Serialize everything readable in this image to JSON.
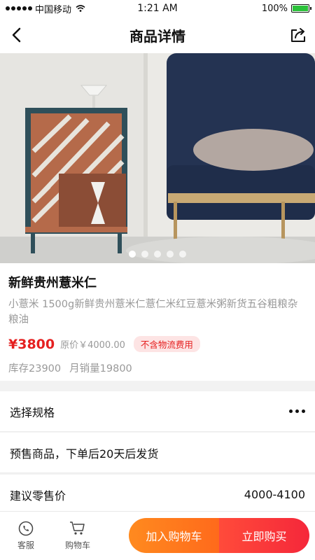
{
  "status_bar": {
    "carrier": "中国移动",
    "time": "1:21 AM",
    "battery": "100%",
    "battery_level": 1.0
  },
  "nav": {
    "title": "商品详情"
  },
  "carousel": {
    "count": 5,
    "active_index": 0
  },
  "product": {
    "name": "新鲜贵州薏米仁",
    "description": "小薏米 1500g新鲜贵州薏米仁薏仁米红豆薏米粥新货五谷粗粮杂粮油",
    "price": "¥3800",
    "original_price": "原价￥4000.00",
    "tag": "不含物流费用",
    "stock": "库存23900",
    "monthly_sales": "月销量19800"
  },
  "rows": {
    "spec_label": "选择规格",
    "presale_label": "预售商品，下单后20天后发货",
    "retail_label": "建议零售价",
    "retail_value": "4000-4100"
  },
  "bottom_bar": {
    "service_label": "客服",
    "cart_label": "购物车",
    "add_to_cart": "加入购物车",
    "buy_now": "立即购买"
  },
  "colors": {
    "accent_red": "#e52020",
    "cart_orange": "#ff7a1e",
    "buy_red": "#f5273a",
    "battery_green": "#2bc23a"
  }
}
